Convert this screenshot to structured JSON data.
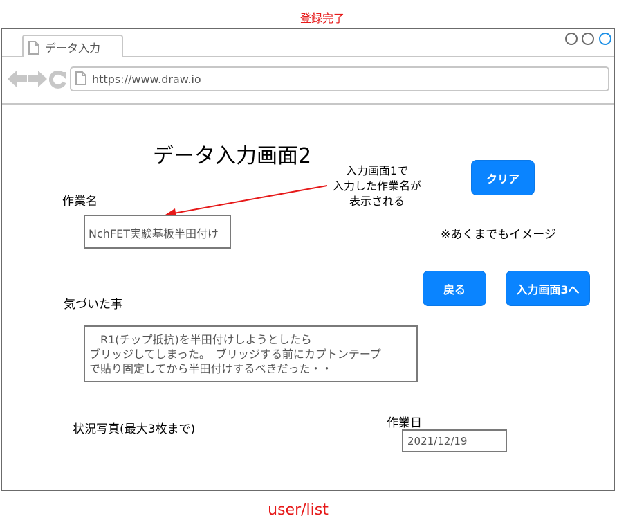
{
  "header_label": "登録完了",
  "footer_label": "user/list",
  "browser": {
    "tab_title": "データ入力",
    "url": "https://www.draw.io"
  },
  "page": {
    "title": "データ入力画面2",
    "annotation_lines": [
      "入力画面1で",
      "入力した作業名が",
      "表示される"
    ],
    "note": "※あくまでもイメージ"
  },
  "buttons": {
    "clear": "クリア",
    "back": "戻る",
    "next": "入力画面3へ"
  },
  "form": {
    "work_name_label": "作業名",
    "work_name_value": "NchFET実験基板半田付け",
    "notes_label": "気づいた事",
    "notes_lines": [
      "　R1(チップ抵抗)を半田付けしようとしたら",
      "ブリッジしてしまった。　ブリッジする前にカプトンテープ",
      "で貼り固定してから半田付けするべきだった・・"
    ],
    "photos_label": "状況写真(最大3枚まで)",
    "date_label": "作業日",
    "date_value": "2021/12/19"
  },
  "colors": {
    "accent_red": "#e61919",
    "button_blue": "#0a84ff",
    "window_circle_active": "#1e90e6"
  },
  "icons": [
    "page-icon",
    "back-arrow-icon",
    "forward-arrow-icon",
    "reload-icon",
    "window-circle-icon"
  ]
}
